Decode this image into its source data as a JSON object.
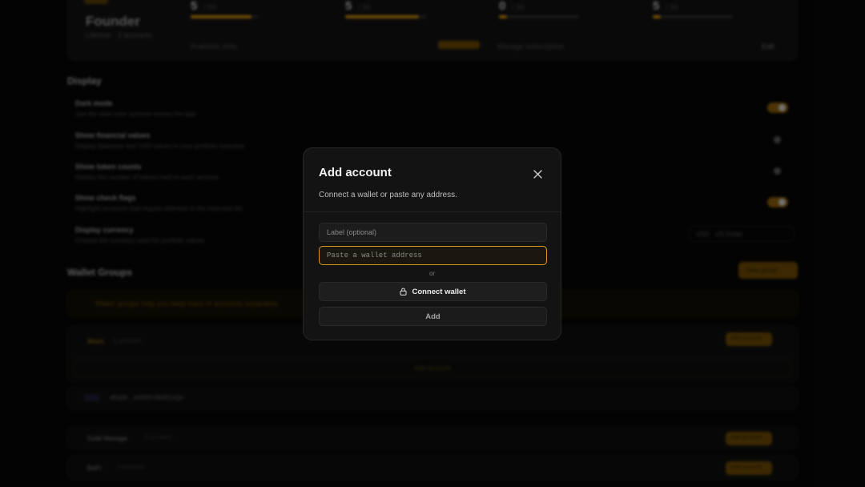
{
  "background": {
    "tier_name": "Founder",
    "tier_sub": "Lifetime · 3 accounts",
    "stats": [
      {
        "num": "5",
        "unit": "/ 10",
        "progress": 0.9
      },
      {
        "num": "5",
        "unit": "/ 10",
        "progress": 0.9
      },
      {
        "num": "0",
        "unit": "/ 10",
        "progress": 0.1
      },
      {
        "num": "5",
        "unit": "/ 10",
        "progress": 0.1
      }
    ],
    "top_small_a": "Available slots",
    "top_small_b": "Manage subscription",
    "top_small_c": "Edit",
    "display_section": "Display",
    "settings": [
      {
        "name": "Dark mode",
        "desc": "Use the dark color scheme across the app",
        "on": true
      },
      {
        "name": "Show financial values",
        "desc": "Display balances and USD values in your portfolio overview",
        "on": false
      },
      {
        "name": "Show token counts",
        "desc": "Display the number of tokens held in each account",
        "on": false
      },
      {
        "name": "Show check flags",
        "desc": "Highlight accounts that require attention in the overview list",
        "on": true
      },
      {
        "name": "Display currency",
        "desc": "Choose the currency used for portfolio values",
        "on": null
      }
    ],
    "currency_select": "USD · US Dollar",
    "wallet_groups_title": "Wallet Groups",
    "new_group_label": "New group",
    "banner_text": "Wallet groups help you keep track of accounts separately",
    "groups": [
      {
        "name": "Main",
        "meta": "1 account"
      },
      {
        "name": "Hardware wallet",
        "meta": "dKqW…mHf3Yz9nR1xQv"
      },
      {
        "name": "Cold Storage",
        "meta": "0 accounts"
      },
      {
        "name": "DeFi",
        "meta": "0 accounts"
      }
    ],
    "add_account_dashed": "Add account",
    "group_action": "Add account"
  },
  "modal": {
    "title": "Add account",
    "subtitle": "Connect a wallet or paste any address.",
    "label_placeholder": "Label (optional)",
    "address_placeholder": "Paste a wallet address",
    "or_text": "or",
    "connect_label": "Connect wallet",
    "add_label": "Add",
    "close_icon": "close-icon",
    "lock_icon": "lock-icon"
  },
  "colors": {
    "accent": "#d89a1e",
    "modal_bg": "#131313",
    "page_bg": "#070707"
  }
}
